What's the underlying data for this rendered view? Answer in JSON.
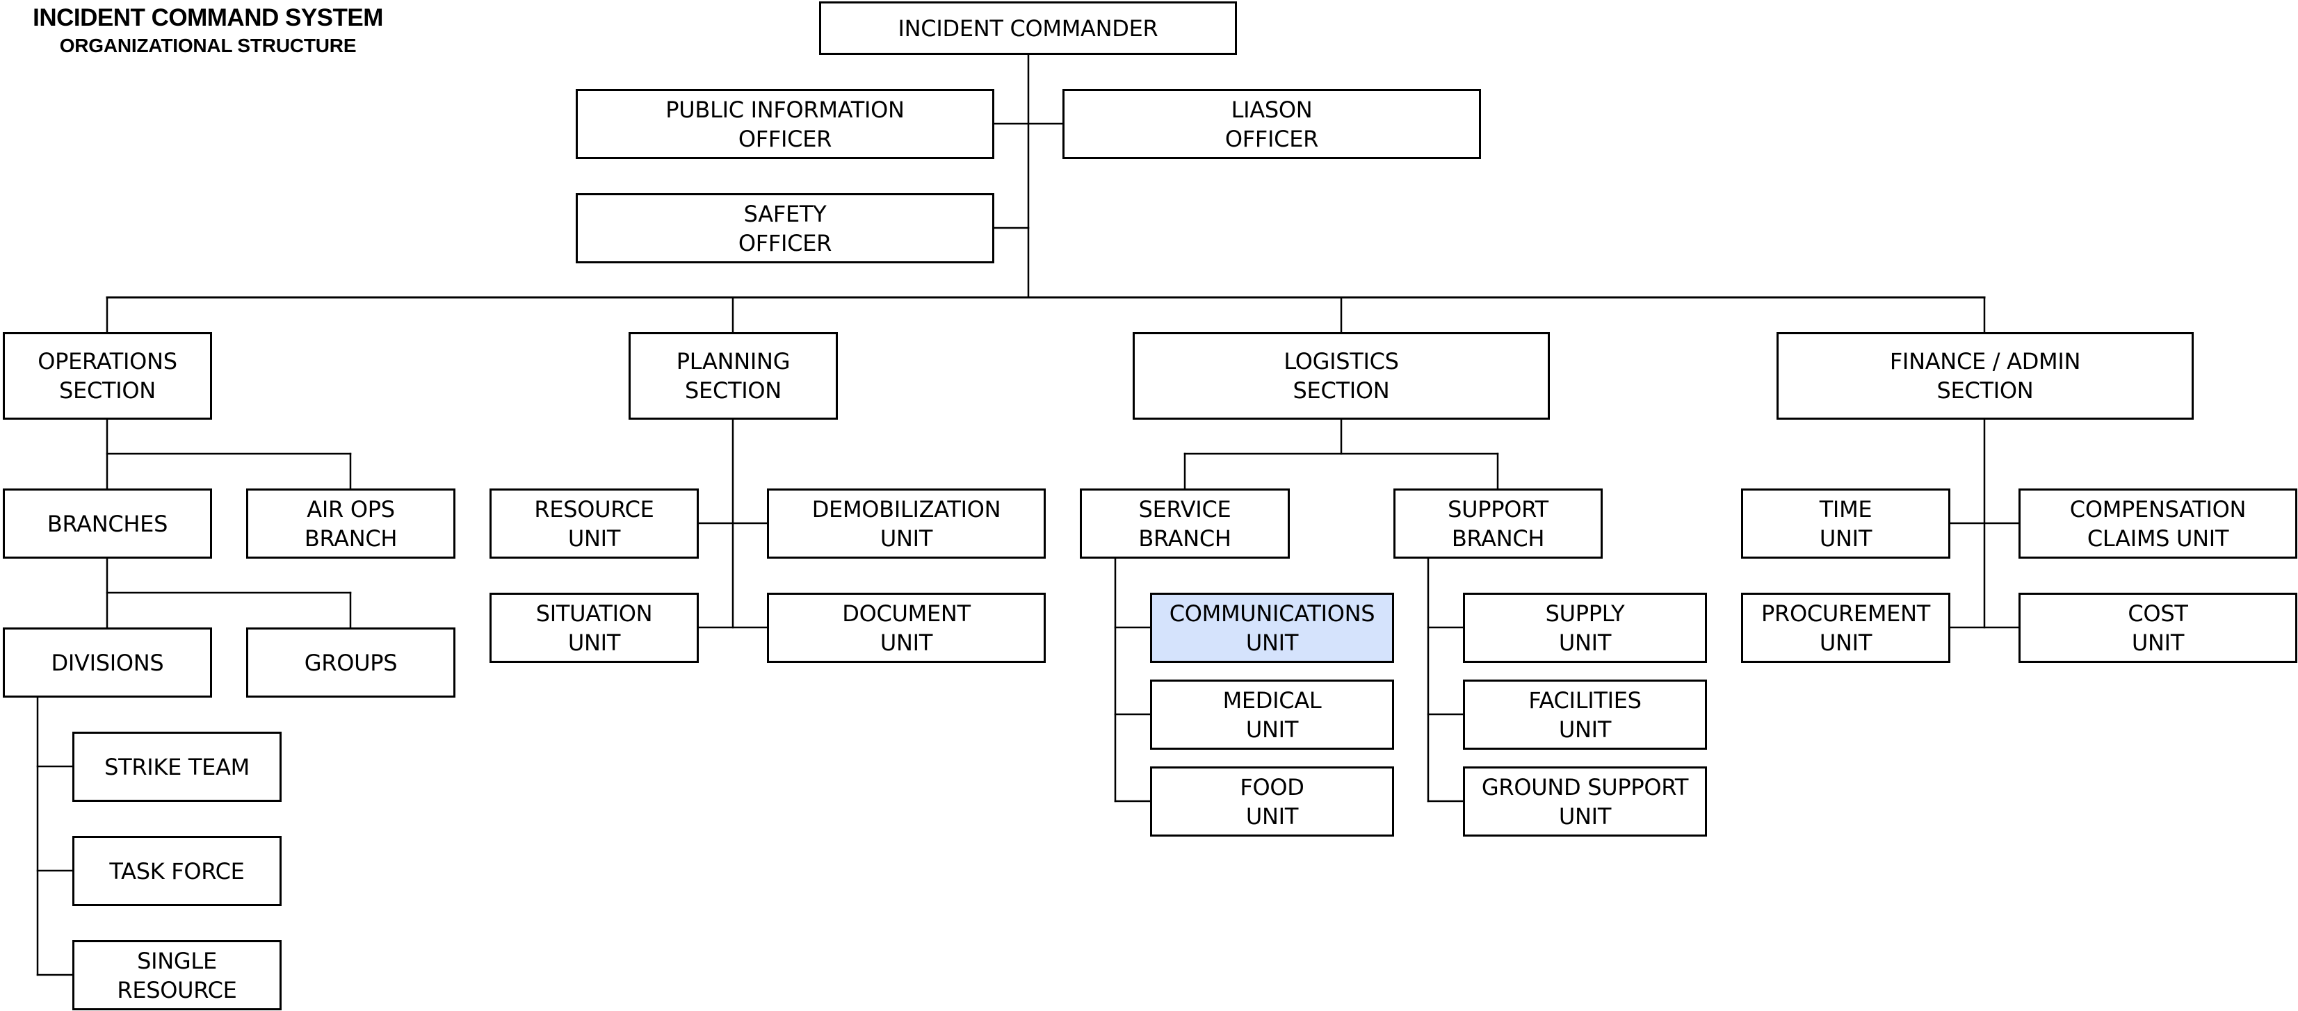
{
  "title": {
    "line1": "INCIDENT COMMAND SYSTEM",
    "line2": "ORGANIZATIONAL STRUCTURE"
  },
  "colors": {
    "highlight_fill": "#d5e3fc",
    "box_border": "#000000",
    "connector": "#000000"
  },
  "nodes": {
    "incident_commander": {
      "lines": [
        "INCIDENT COMMANDER"
      ]
    },
    "public_information_officer": {
      "lines": [
        "PUBLIC INFORMATION",
        "OFFICER"
      ]
    },
    "liason_officer": {
      "lines": [
        "LIASON",
        "OFFICER"
      ]
    },
    "safety_officer": {
      "lines": [
        "SAFETY",
        "OFFICER"
      ]
    },
    "operations_section": {
      "lines": [
        "OPERATIONS",
        "SECTION"
      ]
    },
    "planning_section": {
      "lines": [
        "PLANNING",
        "SECTION"
      ]
    },
    "logistics_section": {
      "lines": [
        "LOGISTICS",
        "SECTION"
      ]
    },
    "finance_admin_section": {
      "lines": [
        "FINANCE / ADMIN",
        "SECTION"
      ]
    },
    "branches": {
      "lines": [
        "BRANCHES"
      ]
    },
    "air_ops_branch": {
      "lines": [
        "AIR OPS",
        "BRANCH"
      ]
    },
    "divisions": {
      "lines": [
        "DIVISIONS"
      ]
    },
    "groups": {
      "lines": [
        "GROUPS"
      ]
    },
    "strike_team": {
      "lines": [
        "STRIKE TEAM"
      ]
    },
    "task_force": {
      "lines": [
        "TASK FORCE"
      ]
    },
    "single_resource": {
      "lines": [
        "SINGLE",
        "RESOURCE"
      ]
    },
    "resource_unit": {
      "lines": [
        "RESOURCE",
        "UNIT"
      ]
    },
    "demobilization_unit": {
      "lines": [
        "DEMOBILIZATION",
        "UNIT"
      ]
    },
    "situation_unit": {
      "lines": [
        "SITUATION",
        "UNIT"
      ]
    },
    "document_unit": {
      "lines": [
        "DOCUMENT",
        "UNIT"
      ]
    },
    "service_branch": {
      "lines": [
        "SERVICE",
        "BRANCH"
      ]
    },
    "support_branch": {
      "lines": [
        "SUPPORT",
        "BRANCH"
      ]
    },
    "communications_unit": {
      "lines": [
        "COMMUNICATIONS",
        "UNIT"
      ],
      "highlighted": true
    },
    "medical_unit": {
      "lines": [
        "MEDICAL",
        "UNIT"
      ]
    },
    "food_unit": {
      "lines": [
        "FOOD",
        "UNIT"
      ]
    },
    "supply_unit": {
      "lines": [
        "SUPPLY",
        "UNIT"
      ]
    },
    "facilities_unit": {
      "lines": [
        "FACILITIES",
        "UNIT"
      ]
    },
    "ground_support_unit": {
      "lines": [
        "GROUND SUPPORT",
        "UNIT"
      ]
    },
    "time_unit": {
      "lines": [
        "TIME",
        "UNIT"
      ]
    },
    "compensation_claims_unit": {
      "lines": [
        "COMPENSATION",
        "CLAIMS UNIT"
      ]
    },
    "procurement_unit": {
      "lines": [
        "PROCUREMENT",
        "UNIT"
      ]
    },
    "cost_unit": {
      "lines": [
        "COST",
        "UNIT"
      ]
    }
  }
}
